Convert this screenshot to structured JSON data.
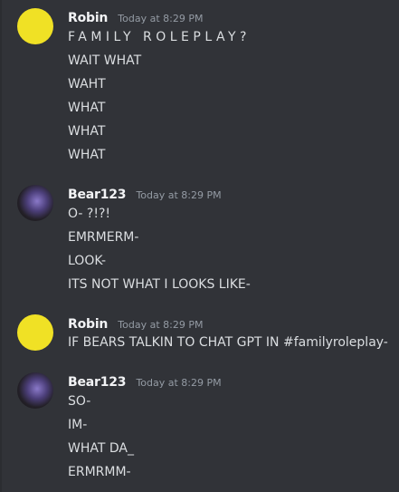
{
  "messages": [
    {
      "author": "Robin",
      "timestamp": "Today at 8:29 PM",
      "avatar": "yellow-avatar",
      "lines": [
        "FAMILY   ROLEPLAY?",
        "WAIT WHAT",
        "WAHT",
        "WHAT",
        "WHAT",
        "WHAT"
      ]
    },
    {
      "author": "Bear123",
      "timestamp": "Today at 8:29 PM",
      "avatar": "bear-avatar",
      "lines": [
        "O- ?!?!",
        "EMRMERM-",
        "LOOK-",
        "ITS NOT WHAT I LOOKS LIKE-"
      ]
    },
    {
      "author": "Robin",
      "timestamp": "Today at 8:29 PM",
      "avatar": "yellow-avatar",
      "lines": [
        "IF BEARS TALKIN TO CHAT GPT IN #familyroleplay-"
      ]
    },
    {
      "author": "Bear123",
      "timestamp": "Today at 8:29 PM",
      "avatar": "bear-avatar",
      "lines": [
        "SO-",
        "IM-",
        "WHAT DA_",
        "ERMRMM-"
      ]
    }
  ],
  "colors": {
    "background": "#313338",
    "username": "#f2f3f5",
    "timestamp": "#949ba4",
    "message_text": "#dbdee1",
    "robin_avatar": "#f0e125"
  }
}
